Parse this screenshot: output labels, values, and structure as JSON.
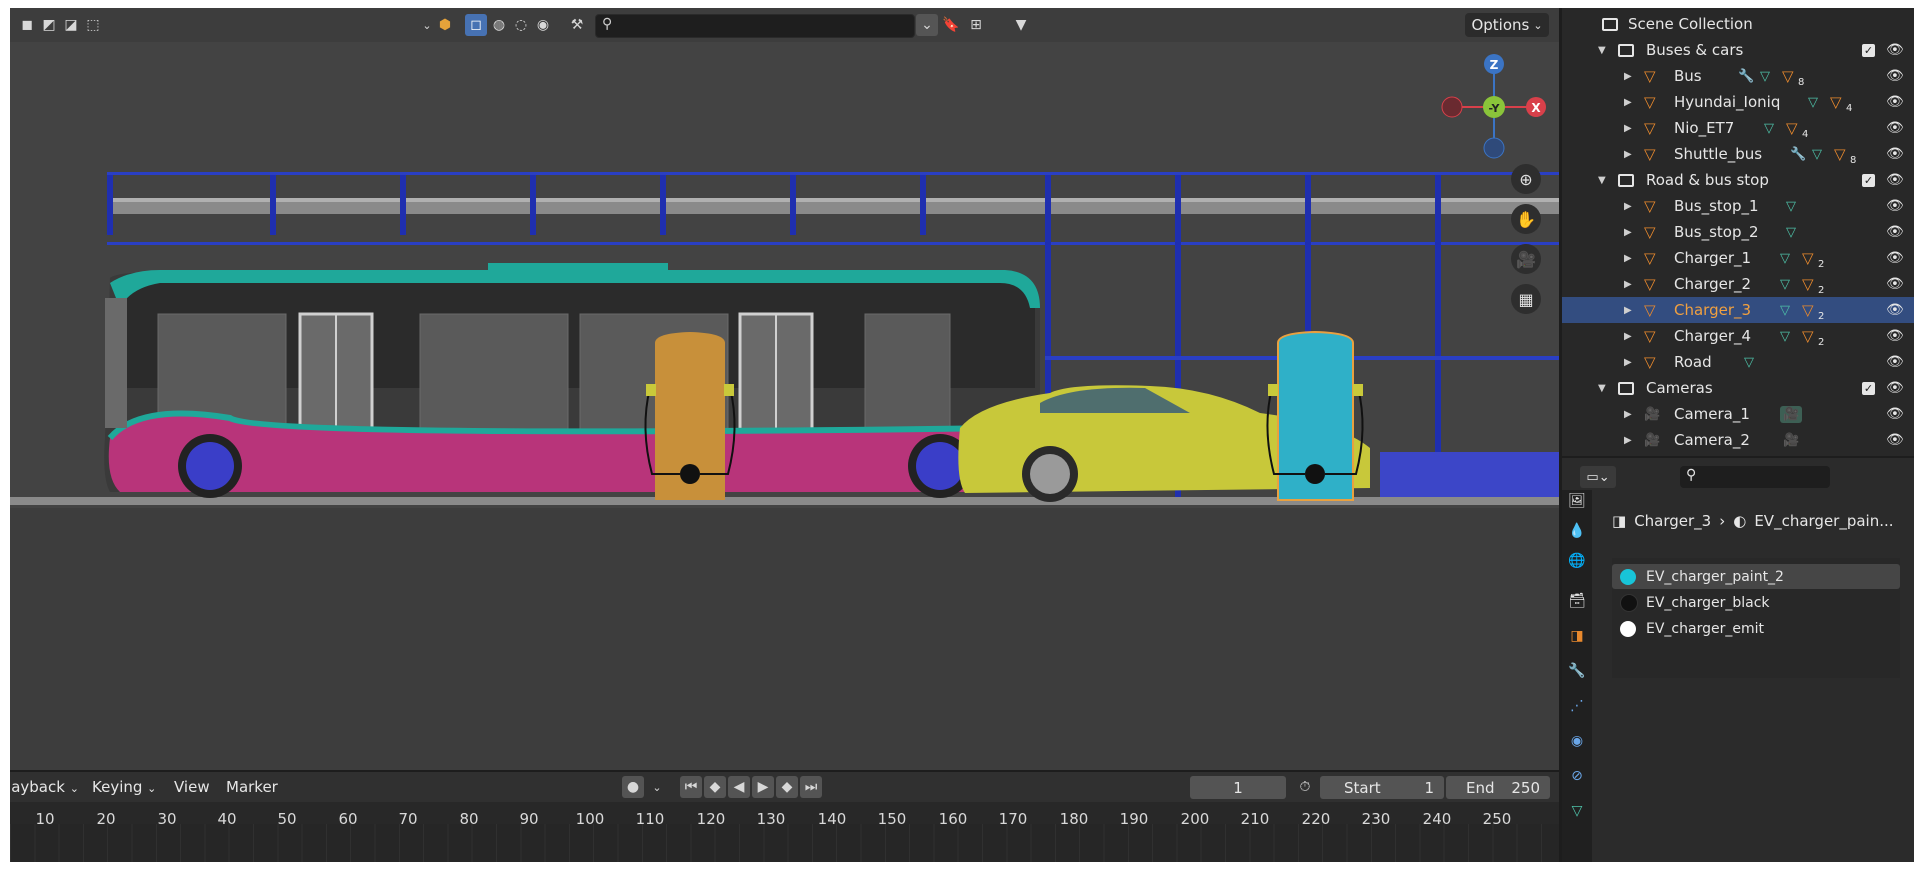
{
  "viewport": {
    "search_placeholder": "",
    "options_label": "Options",
    "gizmo": {
      "z": "Z",
      "y": "-Y",
      "x": "X"
    },
    "tool_icons": [
      "zoom-icon",
      "hand-pan-icon",
      "camera-icon",
      "grid-icon"
    ]
  },
  "outliner": {
    "root": "Scene Collection",
    "rows": [
      {
        "label": "Buses & cars",
        "kind": "collection",
        "depth": 1,
        "expanded": true,
        "checked": true
      },
      {
        "label": "Bus",
        "kind": "object",
        "depth": 2,
        "modifier": true,
        "mesh": true,
        "materials": "8"
      },
      {
        "label": "Hyundai_Ioniq",
        "kind": "object",
        "depth": 2,
        "modifier": false,
        "mesh": true,
        "materials": "4"
      },
      {
        "label": "Nio_ET7",
        "kind": "object",
        "depth": 2,
        "modifier": false,
        "mesh": true,
        "materials": "4"
      },
      {
        "label": "Shuttle_bus",
        "kind": "object",
        "depth": 2,
        "modifier": true,
        "mesh": true,
        "materials": "8"
      },
      {
        "label": "Road & bus stop",
        "kind": "collection",
        "depth": 1,
        "expanded": true,
        "checked": true
      },
      {
        "label": "Bus_stop_1",
        "kind": "object",
        "depth": 2,
        "mesh": true,
        "materials": ""
      },
      {
        "label": "Bus_stop_2",
        "kind": "object",
        "depth": 2,
        "mesh": true,
        "materials": ""
      },
      {
        "label": "Charger_1",
        "kind": "object",
        "depth": 2,
        "mesh": true,
        "materials": "2"
      },
      {
        "label": "Charger_2",
        "kind": "object",
        "depth": 2,
        "mesh": true,
        "materials": "2"
      },
      {
        "label": "Charger_3",
        "kind": "object",
        "depth": 2,
        "mesh": true,
        "materials": "2",
        "selected": true
      },
      {
        "label": "Charger_4",
        "kind": "object",
        "depth": 2,
        "mesh": true,
        "materials": "2"
      },
      {
        "label": "Road",
        "kind": "object",
        "depth": 2,
        "mesh": true,
        "materials": ""
      },
      {
        "label": "Cameras",
        "kind": "collection",
        "depth": 1,
        "expanded": true,
        "checked": true
      },
      {
        "label": "Camera_1",
        "kind": "camera",
        "depth": 2
      },
      {
        "label": "Camera_2",
        "kind": "camera",
        "depth": 2
      }
    ]
  },
  "properties": {
    "breadcrumb_object": "Charger_3",
    "breadcrumb_material": "EV_charger_pain...",
    "materials": [
      {
        "name": "EV_charger_paint_2",
        "color": "#18c4d8",
        "selected": true
      },
      {
        "name": "EV_charger_black",
        "color": "#111111",
        "selected": false
      },
      {
        "name": "EV_charger_emit",
        "color": "#ffffff",
        "selected": false
      }
    ]
  },
  "timeline": {
    "menus": [
      "Playback",
      "Keying",
      "View",
      "Marker"
    ],
    "current_frame": "1",
    "start_label": "Start",
    "start_value": "1",
    "end_label": "End",
    "end_value": "250",
    "ticks": [
      "10",
      "20",
      "30",
      "40",
      "50",
      "60",
      "70",
      "80",
      "90",
      "100",
      "110",
      "120",
      "130",
      "140",
      "150",
      "160",
      "170",
      "180",
      "190",
      "200",
      "210",
      "220",
      "230",
      "240",
      "250"
    ]
  }
}
